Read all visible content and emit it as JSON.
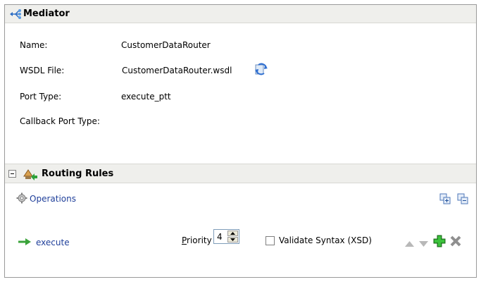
{
  "mediator": {
    "title": "Mediator",
    "icon": "mediator-icon"
  },
  "fields": {
    "name_label": "Name:",
    "name_value": "CustomerDataRouter",
    "wsdl_label": "WSDL File:",
    "wsdl_value": "CustomerDataRouter.wsdl",
    "port_type_label": "Port Type:",
    "port_type_value": "execute_ptt",
    "callback_label": "Callback Port Type:",
    "callback_value": ""
  },
  "routing": {
    "title": "Routing Rules",
    "operations_label": "Operations",
    "operation_name": "execute",
    "priority_label_prefix": "P",
    "priority_label_rest": "riority",
    "priority_value": "4",
    "validate_label": "Validate Syntax (XSD)",
    "validate_checked": false
  },
  "colors": {
    "link": "#1f3f9a",
    "header_bg": "#efefec",
    "add_green": "#2ca02c",
    "arrow_green": "#3aa33a"
  }
}
